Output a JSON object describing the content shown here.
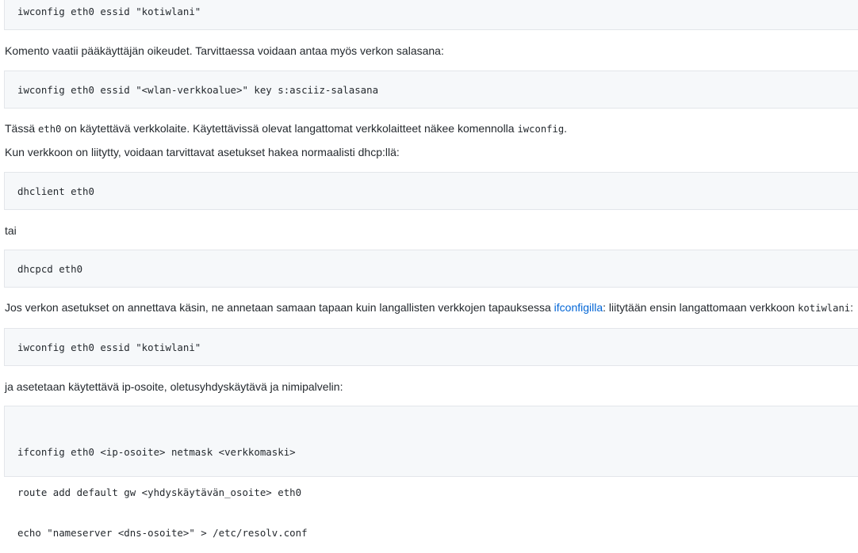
{
  "blocks": {
    "code1": "iwconfig eth0 essid \"kotiwlani\"",
    "p1": "Komento vaatii pääkäyttäjän oikeudet. Tarvittaessa voidaan antaa myös verkon salasana:",
    "code2": "iwconfig eth0 essid \"<wlan-verkkoalue>\" key s:asciiz-salasana",
    "p2": {
      "a": "Tässä ",
      "b": "eth0",
      "c": " on käytettävä verkkolaite. Käytettävissä olevat langattomat verkkolaitteet näkee komennolla ",
      "d": "iwconfig",
      "e": "."
    },
    "p3": "Kun verkkoon on liitytty, voidaan tarvittavat asetukset hakea normaalisti dhcp:llä:",
    "code3": "dhclient eth0",
    "p4": "tai",
    "code4": "dhcpcd eth0",
    "p5": {
      "a": "Jos verkon asetukset on annettava käsin, ne annetaan samaan tapaan kuin langallisten verkkojen tapauksessa ",
      "link": "ifconfigilla",
      "b": ": liitytään ensin langattomaan verkkoon ",
      "c": "kotiwlani",
      "d": ":"
    },
    "code5": "iwconfig eth0 essid \"kotiwlani\"",
    "p6": "ja asetetaan käytettävä ip-osoite, oletusyhdyskäytävä ja nimipalvelin:",
    "code6": [
      "ifconfig eth0 <ip-osoite> netmask <verkkomaski>",
      "route add default gw <yhdyskäytävän_osoite> eth0",
      "echo \"nameserver <dns-osoite>\" > /etc/resolv.conf"
    ]
  }
}
